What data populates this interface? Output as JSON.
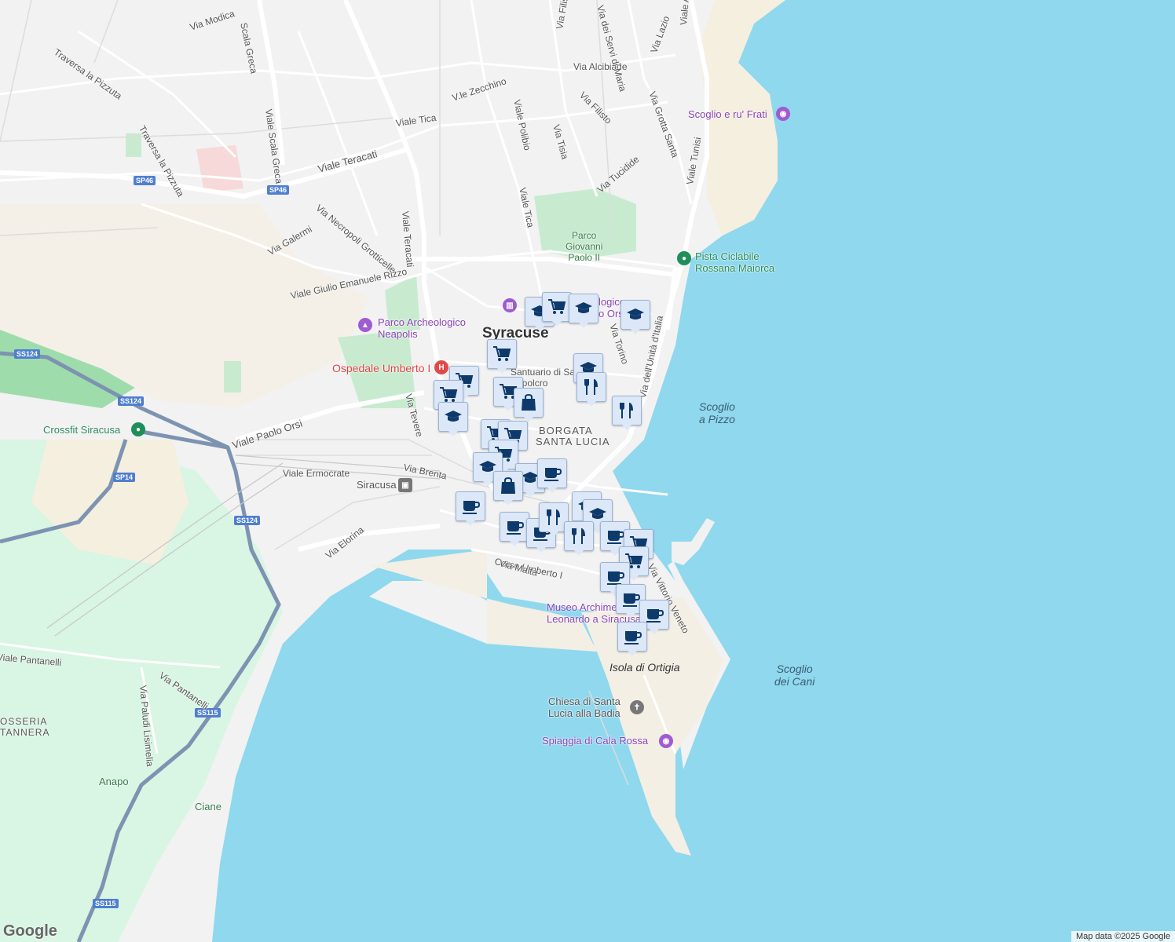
{
  "city": "Syracuse",
  "districts": [
    "BORGATA",
    "SANTA LUCIA"
  ],
  "streets": [
    "Via Modica",
    "Traversa la Pizzuta",
    "Viale Scala Greca",
    "Scala Greca",
    "Traversa la Pizzuta",
    "Viale Teracati",
    "Via Necropoli Grotticelle",
    "Via Galermi",
    "Viale Giulio Emanuele Rizzo",
    "Viale Teracati",
    "Viale Tica",
    "V.le Zecchino",
    "Viale Polibio",
    "Via Tisia",
    "Via Filisto",
    "Via Alcibiade",
    "Via Filisto",
    "Via dei Servi di Maria",
    "Via Lazio",
    "Viale Algeri",
    "Via Grotta Santa",
    "Via Tucidide",
    "Viale Tica",
    "Viale Tunisi",
    "Via Torino",
    "Via dell'Unità d'Italia",
    "Viale Paolo Orsi",
    "Viale Ermocrate",
    "Via Brenta",
    "Via Tevere",
    "Via Elorina",
    "Corso Umberto I",
    "Via Malta",
    "Via Vittorio Veneto",
    "Viale Pantanelli",
    "Via Paludi Lisimelia",
    "Via Pantanelli",
    "Anapo",
    "Ciane"
  ],
  "road_shields": [
    "SP46",
    "SP46",
    "SS124",
    "SS124",
    "SP14",
    "SS124",
    "SS115",
    "SS115"
  ],
  "water_labels": [
    "Scoglio\na Pizzo",
    "Scoglio\ndei Cani",
    "Isola di Ortigia"
  ],
  "pois": {
    "scoglio_frati": "Scoglio e ru' Frati",
    "pista_ciclabile": "Pista Ciclabile\nRossana Maiorca",
    "parco_giovanni": "Parco\nGiovanni\nPaolo II",
    "parco_neapolis": "Parco Archeologico\nNeapolis",
    "ospedale": "Ospedale Umberto I",
    "crossfit": "Crossfit Siracusa",
    "siracusa_station": "Siracusa",
    "museo": "Museo Archimede e\nLeonardo a Siracusa",
    "chiesa": "Chiesa di Santa\nLucia alla Badia",
    "spiaggia": "Spiaggia di Cala Rossa",
    "archeologico_orsi": "logico\no Orsi",
    "sepolcro": "Santuario di Santa\nSepolcro",
    "rosseria": "OSSERIA\nTANNERA"
  },
  "markers": [
    {
      "type": "education"
    },
    {
      "type": "shopping-cart"
    },
    {
      "type": "education"
    },
    {
      "type": "education"
    },
    {
      "type": "shopping-cart"
    },
    {
      "type": "education"
    },
    {
      "type": "restaurant"
    },
    {
      "type": "restaurant"
    },
    {
      "type": "shopping-cart"
    },
    {
      "type": "shopping-cart"
    },
    {
      "type": "shopping-bag"
    },
    {
      "type": "shopping-cart"
    },
    {
      "type": "education"
    },
    {
      "type": "shopping-cart"
    },
    {
      "type": "shopping-cart"
    },
    {
      "type": "shopping-cart"
    },
    {
      "type": "education"
    },
    {
      "type": "education"
    },
    {
      "type": "coffee"
    },
    {
      "type": "shopping-bag"
    },
    {
      "type": "coffee"
    },
    {
      "type": "coffee"
    },
    {
      "type": "coffee"
    },
    {
      "type": "restaurant"
    },
    {
      "type": "education"
    },
    {
      "type": "education"
    },
    {
      "type": "restaurant"
    },
    {
      "type": "coffee"
    },
    {
      "type": "shopping-cart"
    },
    {
      "type": "shopping-cart"
    },
    {
      "type": "coffee"
    },
    {
      "type": "coffee"
    },
    {
      "type": "coffee"
    },
    {
      "type": "coffee"
    }
  ],
  "attribution": "Map data ©2025 Google",
  "logo": "Google",
  "colors": {
    "water": "#8fd8ee",
    "land": "#f1f1f1",
    "park": "#c8ebd0",
    "highway": "#7d93b2",
    "road": "#ffffff",
    "poi_purple": "#8b44b8",
    "poi_green": "#1e8e5a",
    "hospital": "#e04a4a"
  }
}
